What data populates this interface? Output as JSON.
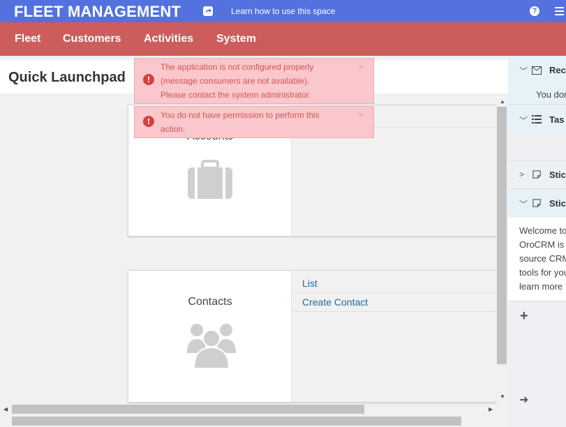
{
  "header": {
    "brand": "FLEET MANAGEMENT",
    "learn_link": "Learn how to use this space",
    "help_glyph": "?"
  },
  "nav": {
    "items": [
      "Fleet",
      "Customers",
      "Activities",
      "System"
    ]
  },
  "page": {
    "title": "Quick Launchpad"
  },
  "alerts": [
    {
      "lines": [
        "The application is not configured properly",
        "(message consumers are not available).",
        "Please contact the system administrator."
      ],
      "close": "×"
    },
    {
      "lines": [
        "You do not have permission to perform this",
        "action."
      ],
      "close": "×"
    }
  ],
  "cards": {
    "accounts": {
      "title": "Accounts",
      "icon": "briefcase-icon"
    },
    "contacts": {
      "title": "Contacts",
      "icon": "users-icon",
      "links": [
        "List",
        "Create Contact"
      ]
    }
  },
  "sidebar": {
    "recent": {
      "label": "Rece",
      "text": "You don"
    },
    "tasks": {
      "label": "Tas"
    },
    "sticky1": {
      "label": "Stic"
    },
    "sticky2": {
      "label": "Stic",
      "text_lines": [
        "Welcome to",
        "OroCRM is",
        "source CRM",
        "tools for you",
        "learn more"
      ]
    },
    "add_glyph": "+",
    "arrow_glyph": "➜"
  },
  "colors": {
    "topbar": "#5372e0",
    "navbar": "#cd5c5c",
    "alert_bg": "#f9c7cc",
    "alert_text": "#d25555",
    "link": "#1f6a9c"
  }
}
